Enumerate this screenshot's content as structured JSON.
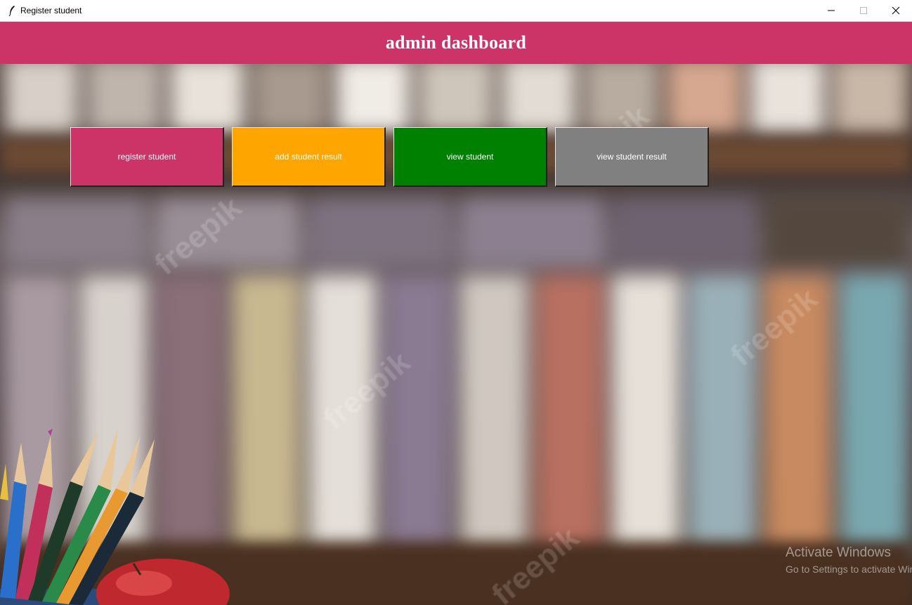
{
  "window": {
    "title": "Register student",
    "icon": "feather-icon"
  },
  "header": {
    "title": "admin dashboard",
    "color": "#cc3366"
  },
  "buttons": [
    {
      "label": "register student",
      "color": "#cc3366"
    },
    {
      "label": "add student result",
      "color": "#ffa500"
    },
    {
      "label": "view student",
      "color": "#008000"
    },
    {
      "label": "view student result",
      "color": "#808080"
    }
  ],
  "watermark": {
    "text": "freepik"
  },
  "system_overlay": {
    "title": "Activate Windows",
    "subtitle": "Go to Settings to activate Windows."
  }
}
